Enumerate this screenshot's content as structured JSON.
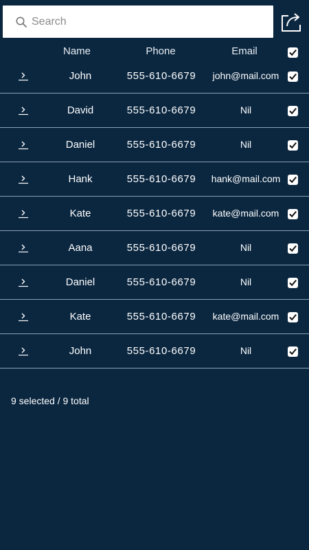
{
  "search": {
    "placeholder": "Search",
    "value": ""
  },
  "header": {
    "name": "Name",
    "phone": "Phone",
    "email": "Email"
  },
  "rows": [
    {
      "name": "John",
      "phone": "555-610-6679",
      "email": "john@mail.com"
    },
    {
      "name": "David",
      "phone": "555-610-6679",
      "email": "Nil"
    },
    {
      "name": "Daniel",
      "phone": "555-610-6679",
      "email": "Nil"
    },
    {
      "name": "Hank",
      "phone": "555-610-6679",
      "email": "hank@mail.com"
    },
    {
      "name": "Kate",
      "phone": "555-610-6679",
      "email": "kate@mail.com"
    },
    {
      "name": "Aana",
      "phone": "555-610-6679",
      "email": "Nil"
    },
    {
      "name": "Daniel",
      "phone": "555-610-6679",
      "email": "Nil"
    },
    {
      "name": "Kate",
      "phone": "555-610-6679",
      "email": "kate@mail.com"
    },
    {
      "name": "John",
      "phone": "555-610-6679",
      "email": "Nil"
    }
  ],
  "footer": {
    "status": "9 selected / 9 total"
  },
  "icons": {
    "search": "search-icon",
    "share": "share-icon",
    "expand": "chevron-right-icon",
    "check": "checkbox-checked-icon"
  },
  "colors": {
    "background": "#0b2740",
    "divider": "#8aa0b5",
    "text": "#ffffff"
  }
}
